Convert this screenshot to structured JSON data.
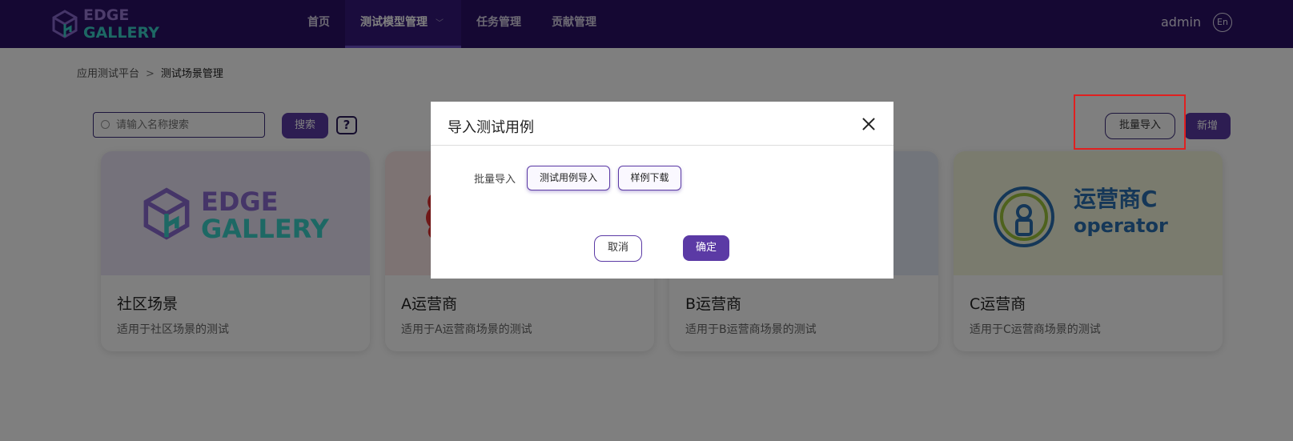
{
  "header": {
    "logo": {
      "line1": "EDGE",
      "line2": "GALLERY"
    },
    "nav": [
      {
        "label": "首页"
      },
      {
        "label": "测试模型管理",
        "active": true,
        "has_dropdown": true
      },
      {
        "label": "任务管理"
      },
      {
        "label": "贡献管理"
      }
    ],
    "user": "admin",
    "lang": "En"
  },
  "breadcrumb": {
    "root": "应用测试平台",
    "separator": ">",
    "current": "测试场景管理"
  },
  "toolbar": {
    "search_placeholder": "请输入名称搜索",
    "search_button": "搜索",
    "help_icon": "?",
    "batch_import": "批量导入",
    "add": "新增"
  },
  "cards": [
    {
      "title": "社区场景",
      "desc": "适用于社区场景的测试",
      "logo_line1": "EDGE",
      "logo_line2": "GALLERY"
    },
    {
      "title": "A运营商",
      "desc": "适用于A运营商场景的测试"
    },
    {
      "title": "B运营商",
      "desc": "适用于B运营商场景的测试"
    },
    {
      "title": "C运营商",
      "desc": "适用于C运营商场景的测试",
      "logo_line1": "运营商C",
      "logo_line2": "operator"
    }
  ],
  "modal": {
    "title": "导入测试用例",
    "field_label": "批量导入",
    "import_button": "测试用例导入",
    "sample_button": "样例下载",
    "cancel": "取消",
    "confirm": "确定"
  },
  "colors": {
    "header_bg": "#2a1166",
    "primary": "#5b3aa5",
    "highlight": "#e02020"
  }
}
